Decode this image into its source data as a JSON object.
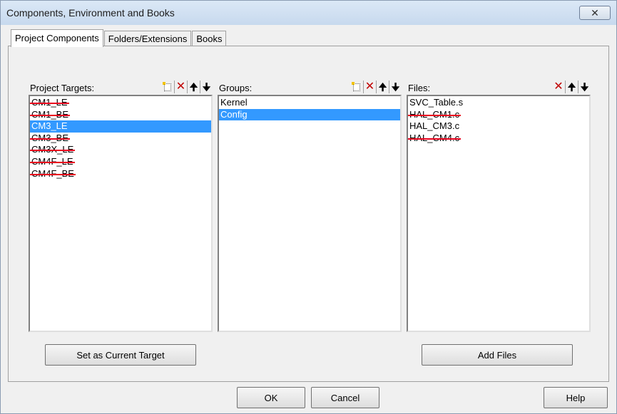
{
  "window": {
    "title": "Components, Environment and Books",
    "close_icon": "close-icon",
    "close_glyph": "✕"
  },
  "tabs": [
    {
      "label": "Project Components",
      "active": true
    },
    {
      "label": "Folders/Extensions",
      "active": false
    },
    {
      "label": "Books",
      "active": false
    }
  ],
  "panes": {
    "targets": {
      "label": "Project Targets:",
      "tools": [
        "new-icon",
        "delete-icon",
        "move-up-icon",
        "move-down-icon"
      ],
      "items": [
        {
          "text": "CM1_LE",
          "selected": false,
          "struck": true
        },
        {
          "text": "CM1_BE",
          "selected": false,
          "struck": true
        },
        {
          "text": "CM3_LE",
          "selected": true,
          "struck": false
        },
        {
          "text": "CM3_BE",
          "selected": false,
          "struck": true
        },
        {
          "text": "CM3X_LE",
          "selected": false,
          "struck": true
        },
        {
          "text": "CM4F_LE",
          "selected": false,
          "struck": true
        },
        {
          "text": "CM4F_BE",
          "selected": false,
          "struck": true
        }
      ]
    },
    "groups": {
      "label": "Groups:",
      "tools": [
        "new-icon",
        "delete-icon",
        "move-up-icon",
        "move-down-icon"
      ],
      "items": [
        {
          "text": "Kernel",
          "selected": false,
          "struck": false
        },
        {
          "text": "Config",
          "selected": true,
          "struck": false
        }
      ]
    },
    "files": {
      "label": "Files:",
      "tools": [
        "delete-icon",
        "move-up-icon",
        "move-down-icon"
      ],
      "items": [
        {
          "text": "SVC_Table.s",
          "selected": false,
          "struck": false
        },
        {
          "text": "HAL_CM1.c",
          "selected": false,
          "struck": true
        },
        {
          "text": "HAL_CM3.c",
          "selected": false,
          "struck": false
        },
        {
          "text": "HAL_CM4.c",
          "selected": false,
          "struck": true
        }
      ]
    }
  },
  "buttons": {
    "set_current": "Set as Current Target",
    "add_files": "Add Files",
    "ok": "OK",
    "cancel": "Cancel",
    "help": "Help"
  },
  "colors": {
    "selection": "#3399ff",
    "strike": "#e8001c",
    "delete_icon": "#c00000"
  }
}
